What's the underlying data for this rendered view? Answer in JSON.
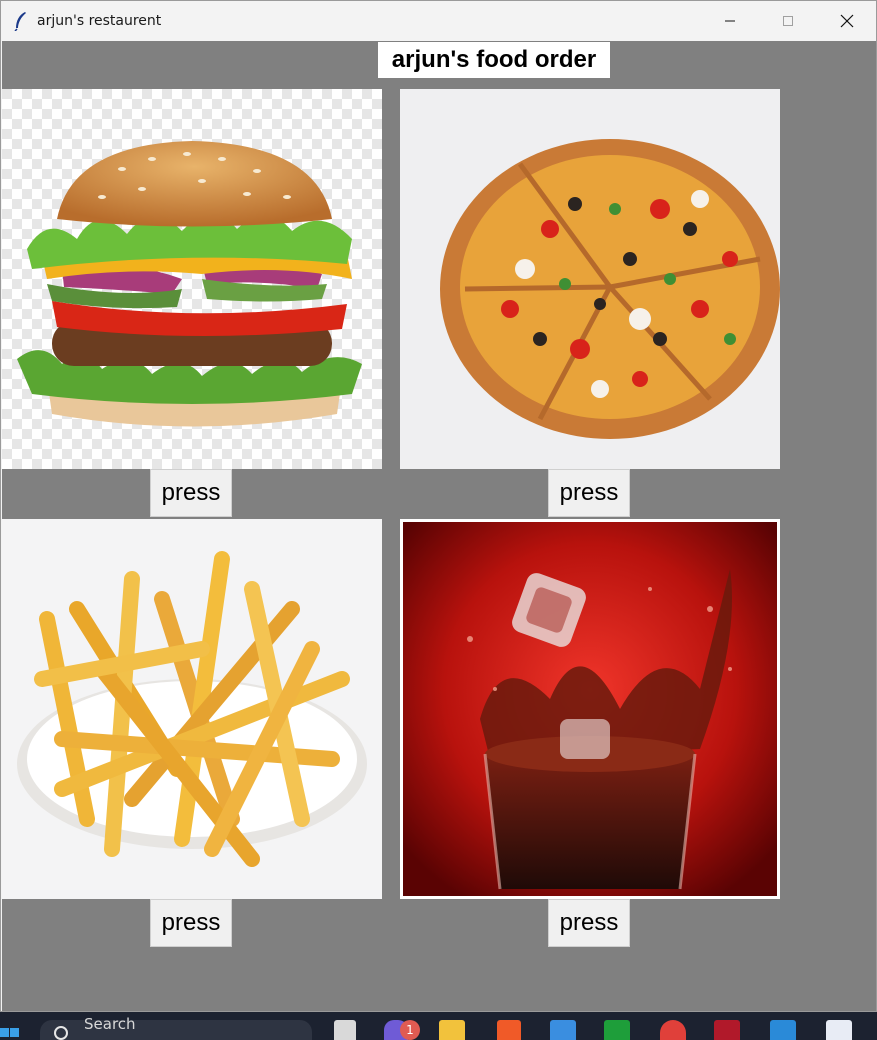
{
  "window": {
    "title": "arjun's restaurent"
  },
  "app": {
    "heading": "arjun's food order",
    "items": [
      {
        "image": "burger-image",
        "button_label": "press"
      },
      {
        "image": "pizza-image",
        "button_label": "press"
      },
      {
        "image": "fries-image",
        "button_label": "press"
      },
      {
        "image": "cola-image",
        "button_label": "press"
      }
    ]
  },
  "taskbar": {
    "search_text": "Search",
    "chat_badge": "1",
    "icons": [
      "windows-start-icon",
      "search-icon",
      "task-view-icon",
      "chat-icon",
      "file-explorer-icon",
      "brave-browser-icon",
      "store-icon",
      "xbox-icon",
      "chrome-icon",
      "app-icon",
      "vscode-icon",
      "notepad-icon"
    ]
  },
  "colors": {
    "window_bg": "#808080",
    "titlebar_bg": "#f3f3f3",
    "button_bg": "#f0f0f0",
    "heading_bg": "#ffffff"
  }
}
